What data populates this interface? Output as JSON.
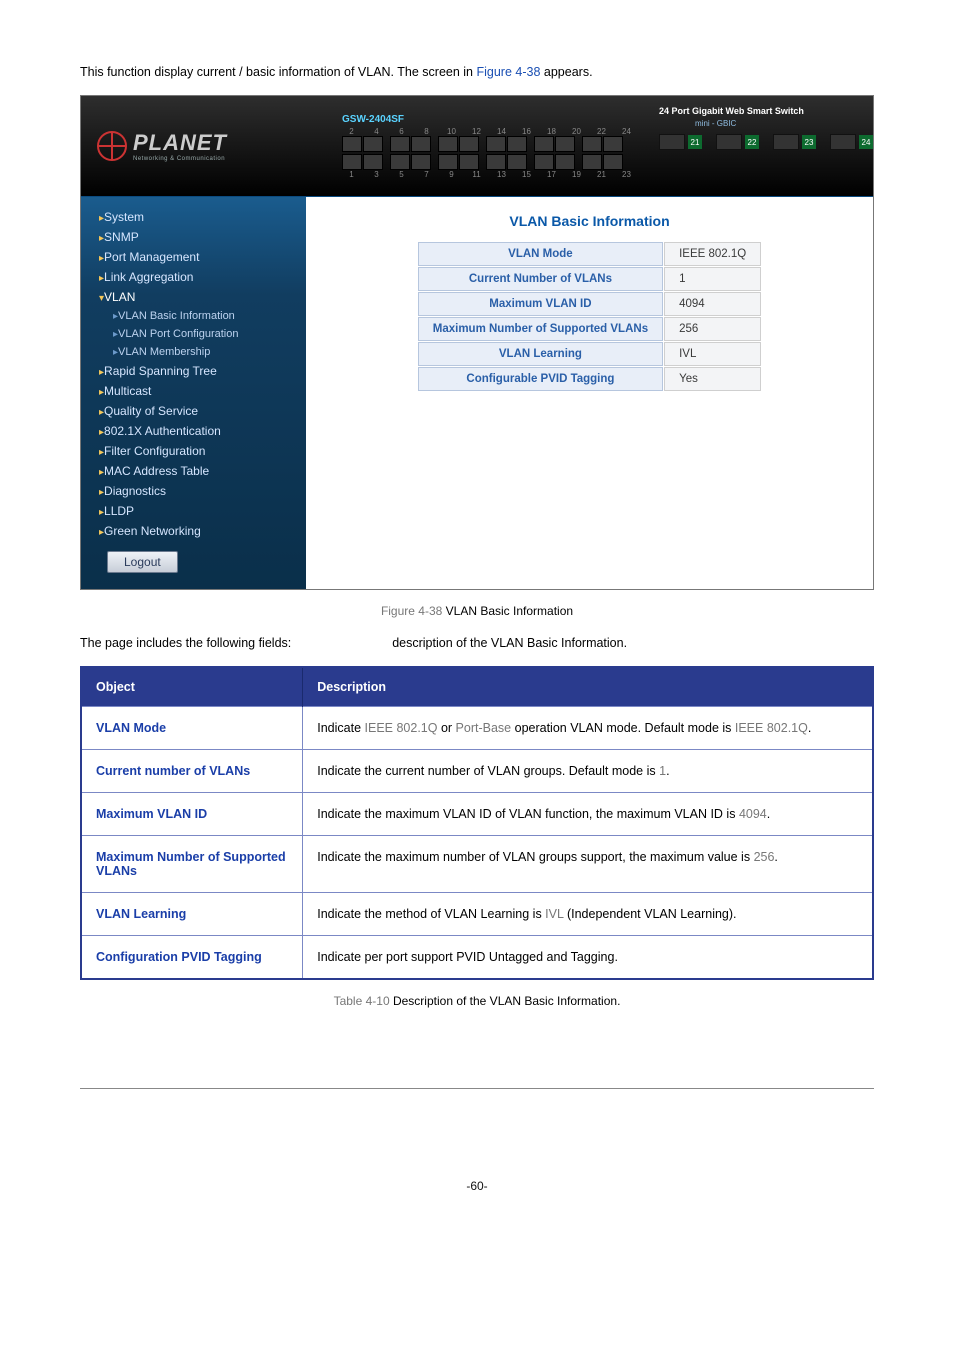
{
  "page": {
    "intro_before": "This function display current / basic information of VLAN. The screen in ",
    "intro_figref": "Figure 4-38",
    "intro_after": " appears.",
    "figure_caption_prefix": "Figure 4-38",
    "figure_caption_text": "VLAN Basic Information",
    "fields_sentence_a": "The page includes the following fields:",
    "fields_sentence_b": "description of the VLAN Basic Information.",
    "table_caption_prefix": "Table 4-10",
    "table_caption_text": "Description of the VLAN Basic Information.",
    "page_number": "-60-"
  },
  "screenshot": {
    "model": "GSW-2404SF",
    "brand": "PLANET",
    "brand_sub": "Networking & Communication",
    "top_label": "24 Port Gigabit Web Smart Switch",
    "gbic_label": "mini - GBIC",
    "port_top_nums": [
      "2",
      "4",
      "6",
      "8",
      "10",
      "12",
      "14",
      "16",
      "18",
      "20",
      "22",
      "24"
    ],
    "port_bottom_nums": [
      "1",
      "3",
      "5",
      "7",
      "9",
      "11",
      "13",
      "15",
      "17",
      "19",
      "21",
      "23"
    ],
    "gbic_nums": [
      "21",
      "22",
      "23",
      "24"
    ],
    "panel_title": "VLAN Basic Information",
    "logout": "Logout",
    "sidebar": [
      {
        "label": "System",
        "type": "mi"
      },
      {
        "label": "SNMP",
        "type": "mi"
      },
      {
        "label": "Port Management",
        "type": "mi"
      },
      {
        "label": "Link Aggregation",
        "type": "mi"
      },
      {
        "label": "VLAN",
        "type": "exp"
      },
      {
        "label": "VLAN Basic Information",
        "type": "sub"
      },
      {
        "label": "VLAN Port Configuration",
        "type": "sub"
      },
      {
        "label": "VLAN Membership",
        "type": "sub"
      },
      {
        "label": "Rapid Spanning Tree",
        "type": "mi"
      },
      {
        "label": "Multicast",
        "type": "mi"
      },
      {
        "label": "Quality of Service",
        "type": "mi"
      },
      {
        "label": "802.1X Authentication",
        "type": "mi"
      },
      {
        "label": "Filter Configuration",
        "type": "mi"
      },
      {
        "label": "MAC Address Table",
        "type": "mi"
      },
      {
        "label": "Diagnostics",
        "type": "mi"
      },
      {
        "label": "LLDP",
        "type": "mi"
      },
      {
        "label": "Green Networking",
        "type": "mi"
      }
    ],
    "info_rows": [
      {
        "k": "VLAN Mode",
        "v": "IEEE 802.1Q"
      },
      {
        "k": "Current Number of VLANs",
        "v": "1"
      },
      {
        "k": "Maximum VLAN ID",
        "v": "4094"
      },
      {
        "k": "Maximum Number of Supported VLANs",
        "v": "256"
      },
      {
        "k": "VLAN Learning",
        "v": "IVL"
      },
      {
        "k": "Configurable PVID Tagging",
        "v": "Yes"
      }
    ]
  },
  "fields_table": {
    "head_object": "Object",
    "head_desc": "Description",
    "rows": [
      {
        "label": "VLAN Mode",
        "desc_segments": [
          "Indicate ",
          "IEEE 802.1Q",
          " or ",
          "Port-Base",
          " operation VLAN mode. Default mode is ",
          "IEEE 802.1Q",
          "."
        ]
      },
      {
        "label": "Current number of VLANs",
        "desc_segments": [
          "Indicate the current number of VLAN groups. Default mode is ",
          "1",
          "."
        ]
      },
      {
        "label": "Maximum VLAN ID",
        "desc_segments": [
          "Indicate the maximum VLAN ID of VLAN function, the maximum VLAN ID is ",
          "4094",
          "."
        ]
      },
      {
        "label": "Maximum Number of Supported VLANs",
        "desc_segments": [
          "Indicate the maximum number of VLAN groups support, the maximum value is ",
          "256",
          "."
        ]
      },
      {
        "label": "VLAN Learning",
        "desc_segments": [
          "Indicate the method of VLAN Learning is ",
          "IVL",
          " (Independent VLAN Learning)."
        ]
      },
      {
        "label": "Configuration PVID Tagging",
        "desc_segments": [
          "Indicate per port support PVID Untagged and Tagging."
        ]
      }
    ]
  }
}
